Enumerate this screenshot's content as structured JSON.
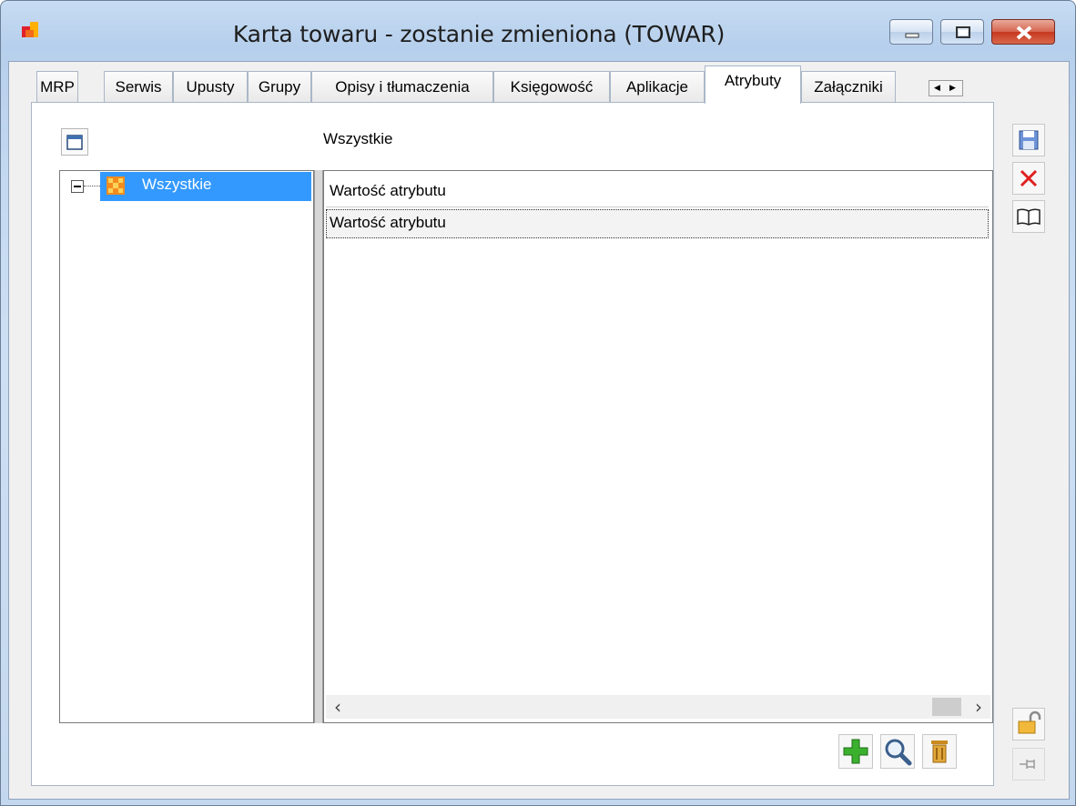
{
  "window": {
    "title": "Karta towaru - zostanie zmieniona (TOWAR)"
  },
  "tabs": [
    {
      "label": "MRP",
      "active": false
    },
    {
      "label": "Serwis",
      "active": false
    },
    {
      "label": "Upusty",
      "active": false
    },
    {
      "label": "Grupy",
      "active": false
    },
    {
      "label": "Opisy i tłumaczenia",
      "active": false
    },
    {
      "label": "Księgowość",
      "active": false
    },
    {
      "label": "Aplikacje",
      "active": false
    },
    {
      "label": "Atrybuty",
      "active": true
    },
    {
      "label": "Załączniki",
      "active": false
    }
  ],
  "attributes": {
    "group_label": "Wszystkie",
    "tree": {
      "root_label": "Wszystkie",
      "expanded": true
    },
    "list": {
      "header": "Wartość atrybutu",
      "rows": [
        "Wartość atrybutu"
      ]
    }
  },
  "colors": {
    "selection": "#3399ff",
    "close_button": "#c5381f",
    "title_bar": "#b6cfec"
  },
  "icons": {
    "save": "floppy-disk",
    "cancel": "red-x",
    "help": "open-book",
    "add": "green-plus",
    "view": "magnifier",
    "delete": "trash-bin",
    "lock": "padlock-open",
    "pin": "pushpin"
  }
}
